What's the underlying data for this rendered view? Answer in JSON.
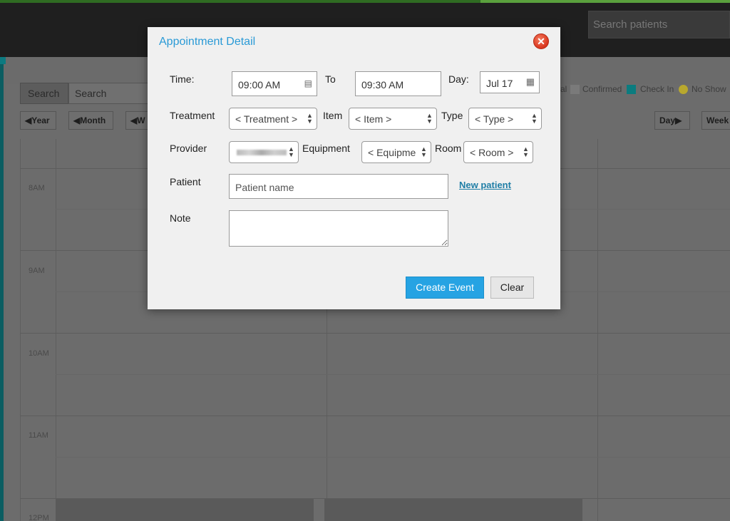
{
  "topbar": {
    "search_placeholder": "Search patients"
  },
  "calendar": {
    "search_button": "Search",
    "search_placeholder": "Search",
    "nav": {
      "year": "Year",
      "month": "Month",
      "week_prev": "W",
      "day_next": "Day",
      "week_next": "Week"
    },
    "legend": {
      "partial_label": "al",
      "confirmed": "Confirmed",
      "check_in": "Check In",
      "no_show": "No Show"
    },
    "hours": [
      "8AM",
      "9AM",
      "10AM",
      "11AM",
      "12PM"
    ],
    "colors": {
      "check_in": "#0b7c7f",
      "no_show": "#b8a82e",
      "confirmed": "#7a7a7a"
    }
  },
  "modal": {
    "title": "Appointment Detail",
    "close_icon": "close-icon",
    "time_label": "Time:",
    "time_from": "09:00 AM",
    "to_label": "To",
    "time_to": "09:30 AM",
    "day_label": "Day:",
    "day_value": "Jul 17",
    "treatment_label": "Treatment",
    "treatment_value": "< Treatment >",
    "item_label": "Item",
    "item_value": "< Item >",
    "type_label": "Type",
    "type_value": "< Type >",
    "provider_label": "Provider",
    "equipment_label": "Equipment",
    "equipment_value": "< Equipme",
    "room_label": "Room",
    "room_value": "< Room >",
    "patient_label": "Patient",
    "patient_placeholder": "Patient name",
    "new_patient": "New patient",
    "note_label": "Note",
    "create_button": "Create Event",
    "clear_button": "Clear",
    "accent_color": "#2a9ad6"
  }
}
